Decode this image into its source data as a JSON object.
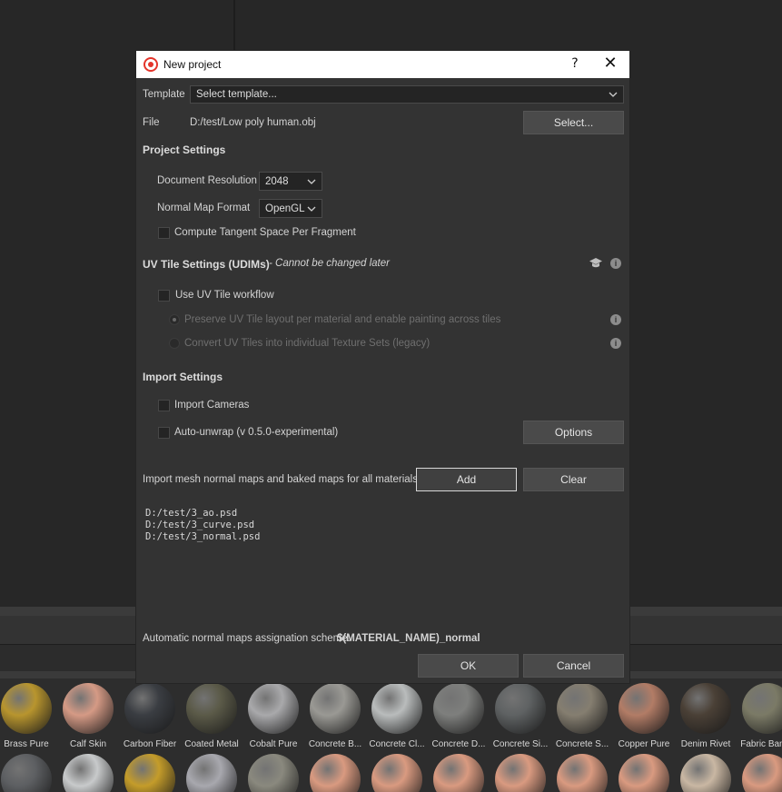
{
  "dialog": {
    "title": "New project",
    "help_label": "?",
    "close_label": "✕"
  },
  "template": {
    "label": "Template",
    "value": "Select template..."
  },
  "file": {
    "label": "File",
    "path": "D:/test/Low poly human.obj",
    "select_label": "Select..."
  },
  "project_settings": {
    "header": "Project Settings",
    "resolution_label": "Document Resolution",
    "resolution_value": "2048",
    "normal_format_label": "Normal Map Format",
    "normal_format_value": "OpenGL",
    "tangent_label": "Compute Tangent Space Per Fragment",
    "tangent_checked": false
  },
  "uv_tile": {
    "header": "UV Tile Settings (UDIMs)",
    "header_note": " - Cannot be changed later",
    "use_label": "Use UV Tile workflow",
    "use_checked": false,
    "option1": "Preserve UV Tile layout per material and enable painting across tiles",
    "option2": "Convert UV Tiles into individual Texture Sets (legacy)",
    "info_glyph": "i"
  },
  "import_settings": {
    "header": "Import Settings",
    "cameras_label": "Import Cameras",
    "unwrap_label": "Auto-unwrap (v 0.5.0-experimental)",
    "options_label": "Options"
  },
  "maps": {
    "description": "Import mesh normal maps and baked maps for all materials.",
    "add_label": "Add",
    "clear_label": "Clear",
    "files": [
      "D:/test/3_ao.psd",
      "D:/test/3_curve.psd",
      "D:/test/3_normal.psd"
    ]
  },
  "scheme": {
    "label": "Automatic normal maps assignation scheme:",
    "value": "$(MATERIAL_NAME)_normal"
  },
  "footer": {
    "ok_label": "OK",
    "cancel_label": "Cancel"
  },
  "materials_row1": [
    {
      "name": "Brass Pure",
      "color": "#b8952e"
    },
    {
      "name": "Calf Skin",
      "color": "#d59a85"
    },
    {
      "name": "Carbon Fiber",
      "color": "#3a3d42"
    },
    {
      "name": "Coated Metal",
      "color": "#5b5a48"
    },
    {
      "name": "Cobalt Pure",
      "color": "#a9a9ab"
    },
    {
      "name": "Concrete B...",
      "color": "#9a9994"
    },
    {
      "name": "Concrete Cl...",
      "color": "#b9bcbc"
    },
    {
      "name": "Concrete D...",
      "color": "#7e7f7d"
    },
    {
      "name": "Concrete Si...",
      "color": "#5f6263"
    },
    {
      "name": "Concrete S...",
      "color": "#857e70"
    },
    {
      "name": "Copper Pure",
      "color": "#b27c66"
    },
    {
      "name": "Denim Rivet",
      "color": "#4a4036"
    },
    {
      "name": "Fabric Bam...",
      "color": "#7b7a66"
    }
  ],
  "materials_row2": [
    {
      "color": "#5d5f62"
    },
    {
      "color": "#c8cacb"
    },
    {
      "color": "#c49c2a"
    },
    {
      "color": "#a8a8ae"
    },
    {
      "color": "#8a897e"
    },
    {
      "color": "#d99a80"
    },
    {
      "color": "#d99a80"
    },
    {
      "color": "#d99a80"
    },
    {
      "color": "#d99a80"
    },
    {
      "color": "#d99a80"
    },
    {
      "color": "#d99a80"
    },
    {
      "color": "#c9b7a3"
    },
    {
      "color": "#d99a80"
    }
  ]
}
